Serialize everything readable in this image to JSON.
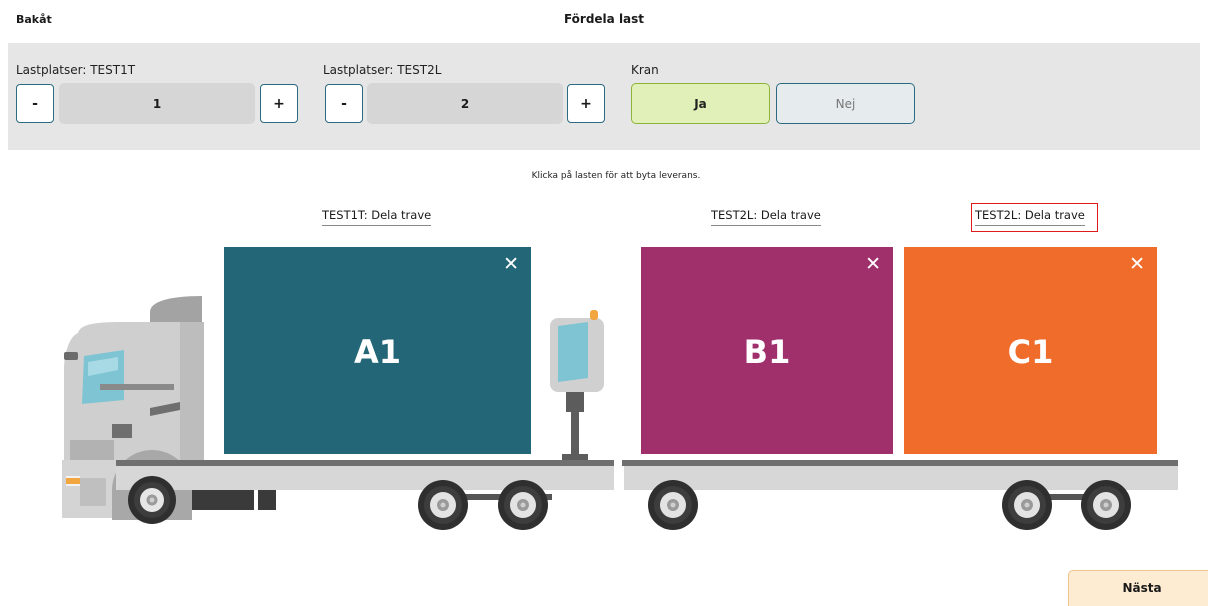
{
  "header": {
    "back_label": "Bakåt",
    "title": "Fördela last"
  },
  "controls": {
    "truck": {
      "label": "Lastplatser: TEST1T",
      "minus": "-",
      "value": "1",
      "plus": "+"
    },
    "trailer": {
      "label": "Lastplatser: TEST2L",
      "minus": "-",
      "value": "2",
      "plus": "+"
    },
    "crane": {
      "label": "Kran",
      "yes": "Ja",
      "no": "Nej",
      "selected": "Ja"
    }
  },
  "hint": "Klicka på lasten för att byta leverans.",
  "split_links": [
    {
      "label": "TEST1T: Dela trave"
    },
    {
      "label": "TEST2L: Dela trave"
    },
    {
      "label": "TEST2L: Dela trave",
      "highlighted": true
    }
  ],
  "cargo": [
    {
      "label": "A1",
      "color": "#226677",
      "remove_icon": "close-icon"
    },
    {
      "label": "B1",
      "color": "#a0306c",
      "remove_icon": "close-icon"
    },
    {
      "label": "C1",
      "color": "#ef6c2b",
      "remove_icon": "close-icon"
    }
  ],
  "next_label": "Nästa",
  "colors": {
    "accent_teal": "#2b6a80",
    "selected_green": "#e1f0b8",
    "highlight_red": "#e01b1b",
    "next_bg": "#fdebd2"
  }
}
